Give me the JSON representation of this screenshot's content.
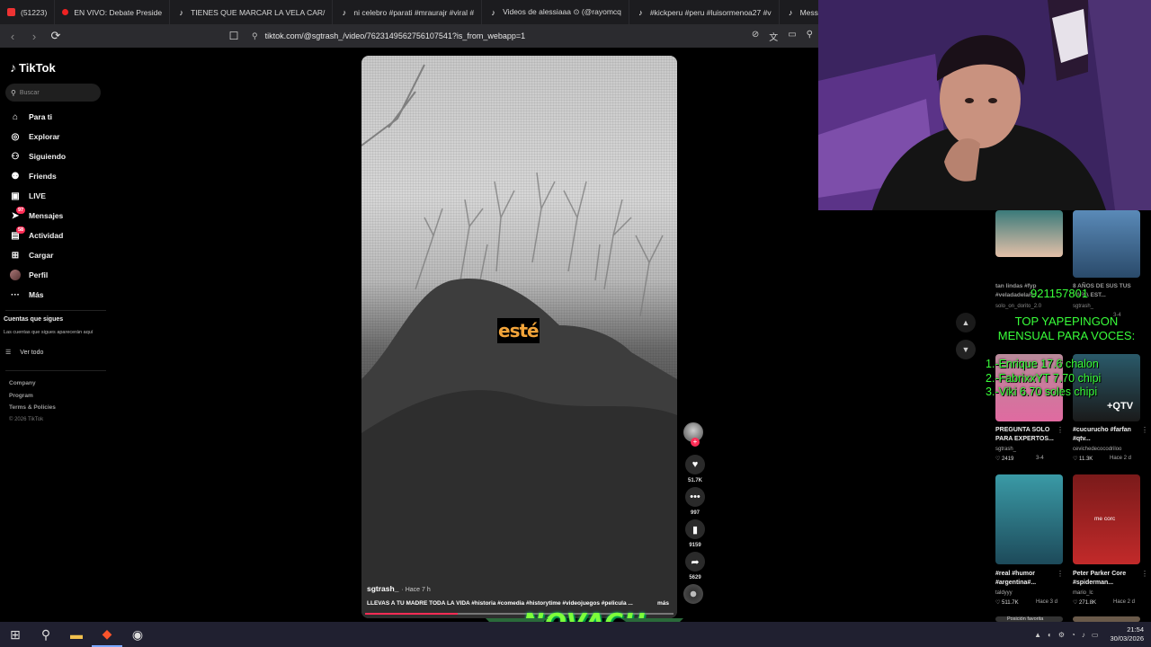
{
  "browser": {
    "tabs": [
      {
        "label": "(51223)",
        "icon": "youtube-icon"
      },
      {
        "label": "EN VIVO: Debate Preside",
        "icon": "live-icon"
      },
      {
        "label": "TIENES QUE MARCAR LA VELA CAR/",
        "icon": "tiktok-icon"
      },
      {
        "label": "ni celebro #parati #mraurajr #viral #",
        "icon": "tiktok-icon"
      },
      {
        "label": "Videos de alessiaaa ⊙ (@rayomcq",
        "icon": "tiktok-icon"
      },
      {
        "label": "#kickperu #peru #luisormenoa27 #v",
        "icon": "tiktok-icon"
      },
      {
        "label": "Messi, el REY de los",
        "icon": "tiktok-icon"
      }
    ],
    "url": "tiktok.com/@sgtrash_/video/7623149562756107541?is_from_webapp=1"
  },
  "sidebar": {
    "logo": "TikTok",
    "search_placeholder": "Buscar",
    "nav": [
      {
        "label": "Para ti",
        "icon": "home-icon"
      },
      {
        "label": "Explorar",
        "icon": "compass-icon"
      },
      {
        "label": "Siguiendo",
        "icon": "following-icon"
      },
      {
        "label": "Friends",
        "icon": "friends-icon"
      },
      {
        "label": "LIVE",
        "icon": "live-tv-icon"
      },
      {
        "label": "Mensajes",
        "icon": "messages-icon",
        "badge": "97"
      },
      {
        "label": "Actividad",
        "icon": "activity-icon",
        "badge": "58"
      },
      {
        "label": "Cargar",
        "icon": "upload-icon"
      },
      {
        "label": "Perfil",
        "icon": "avatar"
      },
      {
        "label": "Más",
        "icon": "more-icon"
      }
    ],
    "following_title": "Cuentas que sigues",
    "following_desc": "Las cuentas que sigues aparecerán aquí",
    "see_all": "Ver todo",
    "footer": [
      "Company",
      "Program",
      "Terms & Policies"
    ],
    "copyright": "© 2026 TikTok"
  },
  "video": {
    "caption_word": "esté",
    "author": "sgtrash_",
    "ago": "· Hace 7 h",
    "description": "LLEVAS A TU MADRE TODA LA VIDA #historia #comedia #historytime #videojuegos #pelicula ...",
    "more": "más",
    "progress": 0.3,
    "likes": "51.7K",
    "comments": "997",
    "saves": "9159",
    "shares": "5629"
  },
  "overlay": {
    "phone": "921157801",
    "title": "TOP YAPEPINGON MENSUAL PARA VOCES:",
    "list": [
      "1.-Enrique 17.6 chalon",
      "2.-FabrixxYT 7.70 chipi",
      "3.-Viki 6.70 soles chipi"
    ],
    "brand": "NOVACH"
  },
  "recs": [
    {
      "title": "tan lindas #fyp #veladadelaño...",
      "author": "solo_on_dorito_2.0",
      "stats": "",
      "meta": "",
      "tag": ""
    },
    {
      "title": "8 AÑOS DE SUS TUS PARA EST...",
      "author": "sgtrash_",
      "stats": "",
      "meta": "3-4",
      "tag": ""
    },
    {
      "title": "PREGUNTA SOLO PARA EXPERTOS...",
      "author": "sgtrash_",
      "stats": "♡ 2419",
      "meta": "3-4",
      "tag": ""
    },
    {
      "title": "#cucurucho #farfan #qtv...",
      "author": "cevichedecocodriloo",
      "stats": "♡ 11.3K",
      "meta": "Hace 2 d",
      "tag": "+QTV"
    },
    {
      "title": "#real #humor #argentina#...",
      "author": "taldyyy",
      "stats": "♡ 511.7K",
      "meta": "Hace 3 d",
      "tag": ""
    },
    {
      "title": "Peter Parker Core #spiderman...",
      "author": "mario_lc",
      "stats": "♡ 271.8K",
      "meta": "Hace 2 d",
      "tag": "me corc"
    },
    {
      "title": "Posición favorita",
      "author": "",
      "stats": "",
      "meta": "",
      "tag": ""
    }
  ],
  "taskbar": {
    "time": "21:54",
    "date": "30/03/2026"
  },
  "colors": {
    "accent": "#fe2c55",
    "overlay_green": "#39ff3a"
  }
}
